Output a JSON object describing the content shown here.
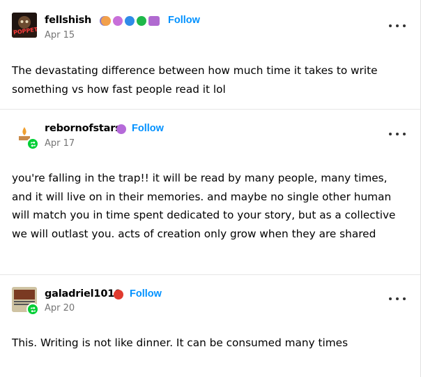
{
  "posts": [
    {
      "username": "fellshish",
      "date": "Apr 15",
      "follow": "Follow",
      "avatar_text": "POPPET",
      "text": "The devastating difference between how much time it takes to write something vs how fast people read it lol"
    },
    {
      "username": "rebornofstars",
      "date": "Apr 17",
      "follow": "Follow",
      "text": "you're falling in the trap!! it will be read by many people, many times, and it will live on in their memories. and maybe no single other human will match you in time spent dedicated to your story, but as a collective we will outlast you. acts of creation only grow when they are shared"
    },
    {
      "username": "galadriel1010",
      "date": "Apr 20",
      "follow": "Follow",
      "text": "This. Writing is not like dinner. It can be consumed many times"
    }
  ],
  "colors": {
    "follow": "#0091ff",
    "reblog": "#00cf35",
    "date": "#747474"
  },
  "icons": {
    "more": "more-options-icon",
    "reblog": "reblog-icon"
  }
}
